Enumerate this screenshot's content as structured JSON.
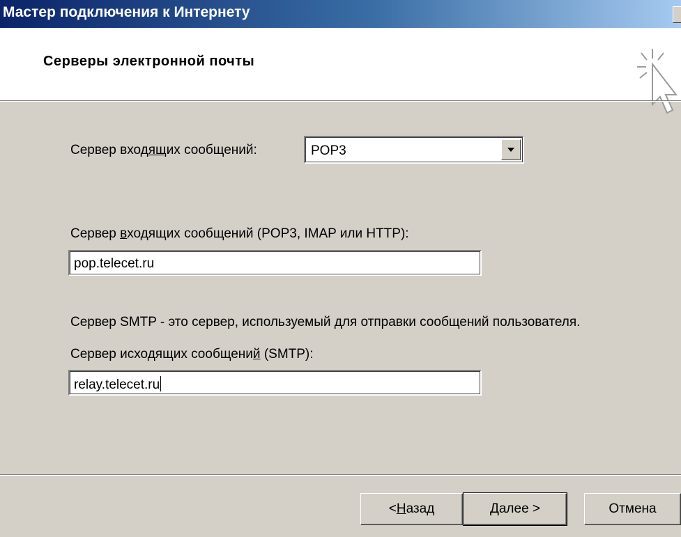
{
  "window": {
    "title": "Мастер подключения к Интернету"
  },
  "header": {
    "title": "Серверы электронной почты",
    "icon": "wizard-cursor-icon"
  },
  "incoming_type": {
    "label_before": "Сервер вход",
    "label_mnemonic": "ящ",
    "label_after": "их сообщений:",
    "selected": "POP3"
  },
  "incoming_server": {
    "label_before": "Сервер ",
    "label_mnemonic": "в",
    "label_after": "ходящих сообщений (POP3, IMAP или HTTP):",
    "value": "pop.telecet.ru"
  },
  "smtp_info": "Сервер SMTP - это сервер, используемый для отправки сообщений  пользователя.",
  "outgoing_server": {
    "label_before": "Сервер исходящих сообщени",
    "label_mnemonic": "й",
    "label_after": " (SMTP):",
    "value": "relay.telecet.ru"
  },
  "buttons": {
    "back_prefix": "< ",
    "back_mnemonic": "Н",
    "back_rest": "азад",
    "next": "Далее >",
    "cancel": "Отмена"
  }
}
